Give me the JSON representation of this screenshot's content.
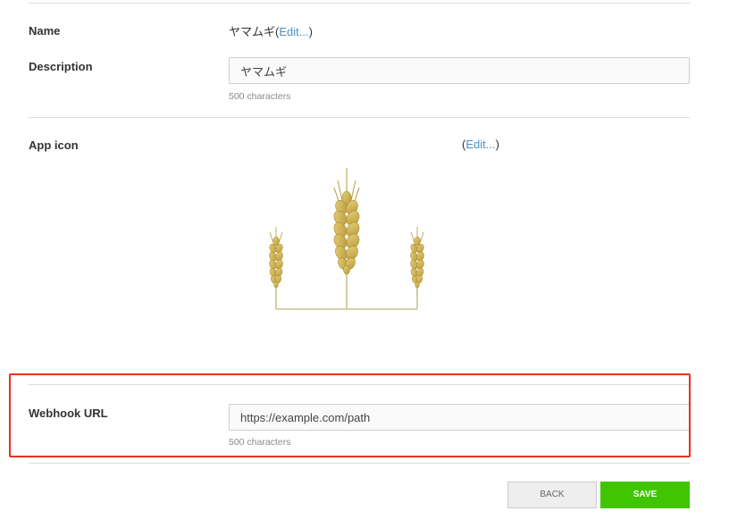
{
  "name_row": {
    "label": "Name",
    "value": "ヤマムギ",
    "edit_open": "(",
    "edit_link": "Edit...",
    "edit_close": ")"
  },
  "description_row": {
    "label": "Description",
    "value": "ヤマムギ",
    "hint": "500 characters"
  },
  "app_icon_row": {
    "label": "App icon",
    "edit_open": "(",
    "edit_link": "Edit...",
    "edit_close": ")",
    "icon": "wheat-icon"
  },
  "webhook_row": {
    "label": "Webhook URL",
    "value": "https://example.com/path",
    "hint": "500 characters"
  },
  "buttons": {
    "back_label": "BACK",
    "save_label": "SAVE"
  },
  "colors": {
    "link": "#4a90c8",
    "save": "#3fc600",
    "highlight": "#e8321c"
  }
}
